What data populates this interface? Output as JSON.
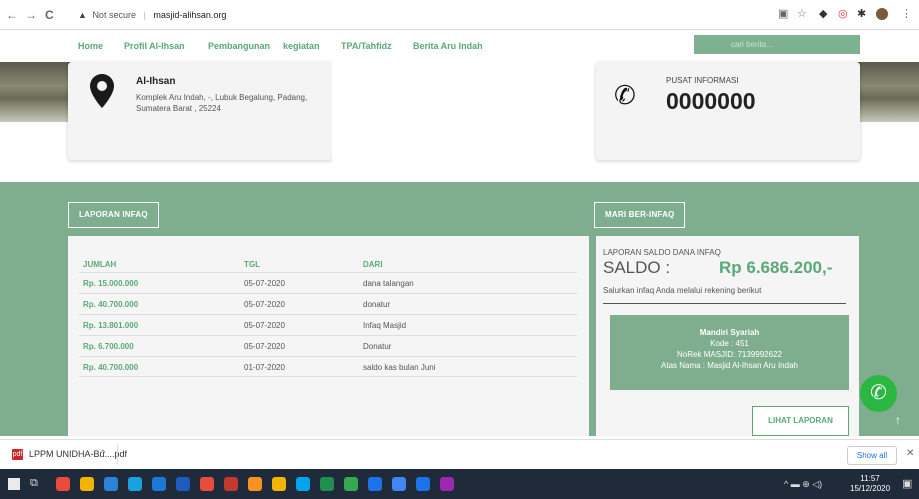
{
  "browser": {
    "back": "←",
    "forward": "→",
    "reload": "C",
    "security_icon": "▲",
    "security_label": "Not secure",
    "separator": "|",
    "url": "masjid-alihsan.org",
    "icons": [
      "translate-icon",
      "star-icon",
      "extension-icon",
      "extension-icon",
      "puzzle-icon",
      "avatar-icon",
      "menu-icon"
    ]
  },
  "nav": {
    "items": [
      "Home",
      "Profil Al-Ihsan",
      "Pembangunan",
      "kegiatan",
      "TPA/Tahfidz",
      "Berita Aru Indah"
    ],
    "search_placeholder": "cari berita..."
  },
  "hero": {
    "org_name": "Al-Ihsan",
    "address": "Komplek Aru Indah, -, Lubuk Begalung, Padang, Sumatera Barat , 25224",
    "info_label": "PUSAT INFORMASI",
    "phone": "0000000"
  },
  "infaq": {
    "tab_label": "LAPORAN INFAQ",
    "headers": [
      "JUMLAH",
      "TGL",
      "DARI"
    ],
    "rows": [
      {
        "amount": "Rp. 15.000.000",
        "date": "05-07-2020",
        "from": "dana talangan"
      },
      {
        "amount": "Rp. 40.700.000",
        "date": "05-07-2020",
        "from": "donatur"
      },
      {
        "amount": "Rp. 13.801.000",
        "date": "05-07-2020",
        "from": "Infaq Masjid"
      },
      {
        "amount": "Rp. 6.700.000",
        "date": "05-07-2020",
        "from": "Donatur"
      },
      {
        "amount": "Rp. 40.700.000",
        "date": "01-07-2020",
        "from": "saldo kas bulan Juni"
      }
    ]
  },
  "berinfaq": {
    "tab_label": "MARI BER-INFAQ",
    "caption": "LAPORAN SALDO DANA INFAQ",
    "saldo_label": "SALDO :",
    "saldo_value": "Rp 6.686.200,-",
    "note": "Salurkan infaq Anda melalui rekening berikut",
    "bank_name": "Mandiri Syariah",
    "bank_code": "Kode : 451",
    "account": "NoRek MASJID: 7139992622",
    "holder": "Atas Nama : Masjid Al-Ihsan Aru Indah",
    "button": "LIHAT LAPORAN"
  },
  "floating": {
    "whatsapp_icon": "whatsapp-icon",
    "scroll_top": "↑"
  },
  "downloads": {
    "file_icon": "pdf",
    "file_name": "LPPM UNIDHA-Bu....pdf",
    "chevron": "^",
    "show_all": "Show all",
    "close": "✕"
  },
  "taskbar": {
    "time": "11:57",
    "date": "15/12/2020",
    "tray": "^ ▬ ⊕ ◁)",
    "colors": [
      "#e84b3c",
      "#f3b300",
      "#2b82d9",
      "#1aa1e1",
      "#1b7ad6",
      "#1e5bbd",
      "#e74c3c",
      "#c0392b",
      "#f7931e",
      "#f4b400",
      "#00a4ef",
      "#1e8f4e",
      "#34a853",
      "#1a73e8",
      "#4285f4",
      "#1a73e8",
      "#9c27b0"
    ]
  }
}
